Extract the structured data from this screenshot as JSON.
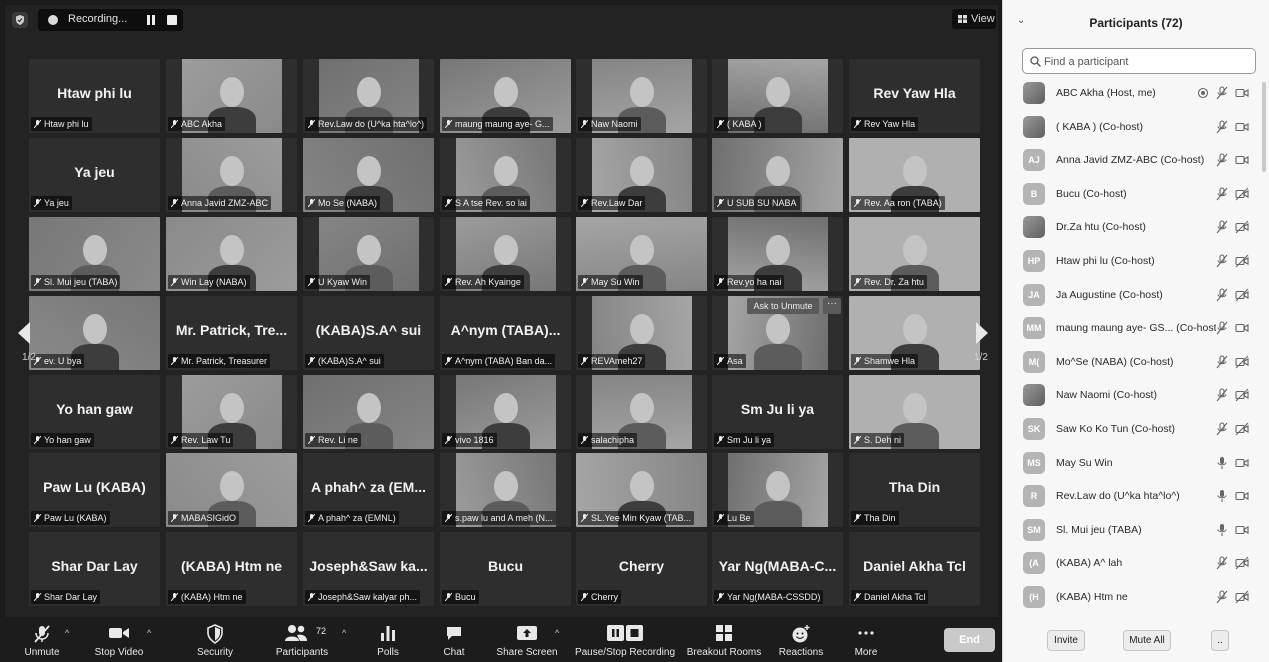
{
  "meeting": {
    "recording_label": "Recording...",
    "view_label": "View",
    "page_indicator_left": "1/2",
    "page_indicator_right": "1/2",
    "ask_unmute_label": "Ask to Unmute",
    "more_dots": "···"
  },
  "tiles": [
    {
      "display": "Htaw phi lu",
      "label": "Htaw phi lu",
      "video": false
    },
    {
      "display": "",
      "label": "ABC Akha",
      "video": true
    },
    {
      "display": "",
      "label": "Rev.Law do (U^ka hta^lo^)",
      "video": true
    },
    {
      "display": "",
      "label": "maung maung aye- G...",
      "video": true
    },
    {
      "display": "",
      "label": "Naw Naomi",
      "video": true
    },
    {
      "display": "",
      "label": "( KABA )",
      "video": true
    },
    {
      "display": "Rev Yaw Hla",
      "label": "Rev Yaw Hla",
      "video": false
    },
    {
      "display": "Ya jeu",
      "label": "Ya jeu",
      "video": false
    },
    {
      "display": "",
      "label": "Anna Javid ZMZ-ABC",
      "video": true
    },
    {
      "display": "",
      "label": "Mo Se (NABA)",
      "video": true
    },
    {
      "display": "",
      "label": "S A tse Rev. so lai",
      "video": true
    },
    {
      "display": "",
      "label": "Rev.Law Dar",
      "video": true
    },
    {
      "display": "",
      "label": "U SUB SU NABA",
      "video": true
    },
    {
      "display": "",
      "label": "Rev. Aa ron (TABA)",
      "video": true
    },
    {
      "display": "",
      "label": "Sl. Mui jeu (TABA)",
      "video": true
    },
    {
      "display": "",
      "label": "Win Lay (NABA)",
      "video": true
    },
    {
      "display": "",
      "label": "U Kyaw Win",
      "video": true
    },
    {
      "display": "",
      "label": "Rev. Ah Kyainge",
      "video": true
    },
    {
      "display": "",
      "label": "May Su Win",
      "video": true,
      "active": true
    },
    {
      "display": "",
      "label": "Rev.yo ha nai",
      "video": true
    },
    {
      "display": "",
      "label": "Rev. Dr. Za htu",
      "video": true
    },
    {
      "display": "",
      "label": "ev. U bya",
      "video": true
    },
    {
      "display": "Mr. Patrick, Tre...",
      "label": "Mr. Patrick, Treasurer",
      "video": false
    },
    {
      "display": "(KABA)S.A^ sui",
      "label": "(KABA)S.A^ sui",
      "video": false
    },
    {
      "display": "A^nym (TABA)...",
      "label": "A^nym (TABA) Ban da...",
      "video": false
    },
    {
      "display": "",
      "label": "REVAmeh27",
      "video": true
    },
    {
      "display": "",
      "label": "Asa",
      "video": true
    },
    {
      "display": "",
      "label": "Shamwe Hla",
      "video": true
    },
    {
      "display": "Yo han gaw",
      "label": "Yo han gaw",
      "video": false
    },
    {
      "display": "",
      "label": "Rev. Law Tu",
      "video": true
    },
    {
      "display": "",
      "label": "Rev. Li ne",
      "video": true
    },
    {
      "display": "",
      "label": "vivo 1816",
      "video": true
    },
    {
      "display": "",
      "label": "salachipha",
      "video": true
    },
    {
      "display": "Sm Ju li ya",
      "label": "Sm Ju li ya",
      "video": false
    },
    {
      "display": "",
      "label": "S. Deh ni",
      "video": true
    },
    {
      "display": "Paw Lu (KABA)",
      "label": "Paw Lu (KABA)",
      "video": false
    },
    {
      "display": "",
      "label": "MABASIGidO",
      "video": true
    },
    {
      "display": "A phah^ za (EM...",
      "label": "A phah^ za (EMNL)",
      "video": false
    },
    {
      "display": "",
      "label": "s.paw lu and A meh (N...",
      "video": true
    },
    {
      "display": "",
      "label": "SL.Yee Min Kyaw (TAB...",
      "video": true
    },
    {
      "display": "",
      "label": "Lu Be",
      "video": true
    },
    {
      "display": "Tha Din",
      "label": "Tha Din",
      "video": false
    },
    {
      "display": "Shar Dar Lay",
      "label": "Shar Dar Lay",
      "video": false
    },
    {
      "display": "(KABA) Htm ne",
      "label": "(KABA) Htm ne",
      "video": false
    },
    {
      "display": "Joseph&Saw ka...",
      "label": "Joseph&Saw kalyar ph...",
      "video": false
    },
    {
      "display": "Bucu",
      "label": "Bucu",
      "video": false
    },
    {
      "display": "Cherry",
      "label": "Cherry",
      "video": false
    },
    {
      "display": "Yar Ng(MABA-C...",
      "label": "Yar Ng(MABA-CSSDD)",
      "video": false
    },
    {
      "display": "Daniel Akha Tcl",
      "label": "Daniel Akha Tcl",
      "video": false
    }
  ],
  "toolbar": {
    "unmute": "Unmute",
    "stop_video": "Stop Video",
    "security": "Security",
    "participants": "Participants",
    "participants_count": "72",
    "polls": "Polls",
    "chat": "Chat",
    "share_screen": "Share Screen",
    "pause_stop_recording": "Pause/Stop Recording",
    "breakout_rooms": "Breakout Rooms",
    "reactions": "Reactions",
    "more": "More",
    "end": "End"
  },
  "panel": {
    "title": "Participants (72)",
    "search_placeholder": "Find a participant",
    "invite": "Invite",
    "mute_all": "Mute All",
    "more": "..",
    "participants": [
      {
        "initials": "",
        "name": "ABC Akha (Host, me)",
        "avatar_img": true,
        "record": true,
        "mic": "muted",
        "cam": "on"
      },
      {
        "initials": "",
        "name": "( KABA ) (Co-host)",
        "avatar_img": true,
        "record": false,
        "mic": "muted",
        "cam": "on"
      },
      {
        "initials": "AJ",
        "name": "Anna Javid ZMZ-ABC (Co-host)",
        "avatar_img": false,
        "record": false,
        "mic": "muted",
        "cam": "on"
      },
      {
        "initials": "B",
        "name": "Bucu (Co-host)",
        "avatar_img": false,
        "record": false,
        "mic": "muted",
        "cam": "off"
      },
      {
        "initials": "",
        "name": "Dr.Za htu (Co-host)",
        "avatar_img": true,
        "record": false,
        "mic": "muted",
        "cam": "off"
      },
      {
        "initials": "HP",
        "name": "Htaw phi lu (Co-host)",
        "avatar_img": false,
        "record": false,
        "mic": "muted",
        "cam": "off"
      },
      {
        "initials": "JA",
        "name": "Ja Augustine (Co-host)",
        "avatar_img": false,
        "record": false,
        "mic": "muted",
        "cam": "off"
      },
      {
        "initials": "MM",
        "name": "maung maung aye- GS... (Co-host)",
        "avatar_img": false,
        "record": false,
        "mic": "muted",
        "cam": "on"
      },
      {
        "initials": "M(",
        "name": "Mo^Se (NABA) (Co-host)",
        "avatar_img": false,
        "record": false,
        "mic": "muted",
        "cam": "off"
      },
      {
        "initials": "",
        "name": "Naw Naomi (Co-host)",
        "avatar_img": true,
        "record": false,
        "mic": "muted",
        "cam": "off"
      },
      {
        "initials": "SK",
        "name": "Saw Ko Ko Tun (Co-host)",
        "avatar_img": false,
        "record": false,
        "mic": "muted",
        "cam": "off"
      },
      {
        "initials": "MS",
        "name": "May Su Win",
        "avatar_img": false,
        "record": false,
        "mic": "on",
        "cam": "on"
      },
      {
        "initials": "R",
        "name": "Rev.Law do (U^ka hta^lo^)",
        "avatar_img": false,
        "record": false,
        "mic": "on",
        "cam": "on"
      },
      {
        "initials": "SM",
        "name": "Sl. Mui jeu (TABA)",
        "avatar_img": false,
        "record": false,
        "mic": "on",
        "cam": "on"
      },
      {
        "initials": "(A",
        "name": "(KABA) A^ lah",
        "avatar_img": false,
        "record": false,
        "mic": "muted",
        "cam": "off"
      },
      {
        "initials": "(H",
        "name": "(KABA) Htm ne",
        "avatar_img": false,
        "record": false,
        "mic": "muted",
        "cam": "off"
      }
    ]
  }
}
